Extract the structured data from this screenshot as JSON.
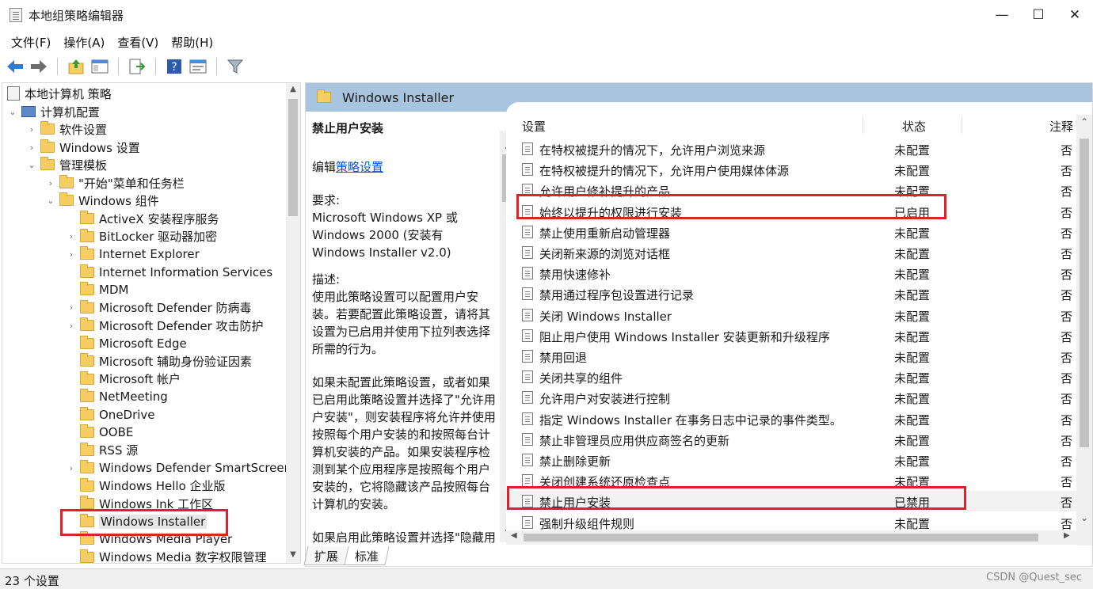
{
  "window": {
    "title": "本地组策略编辑器",
    "minimize": "—",
    "maximize": "☐",
    "close": "✕"
  },
  "menu": [
    "文件(F)",
    "操作(A)",
    "查看(V)",
    "帮助(H)"
  ],
  "toolbar": {
    "back_icon": "back-arrow-icon",
    "forward_icon": "forward-arrow-icon",
    "up_icon": "up-folder-icon",
    "show_hide_icon": "show-hide-tree-icon",
    "export_icon": "export-list-icon",
    "help_icon": "help-icon",
    "properties_icon": "properties-icon",
    "filter_icon": "filter-icon"
  },
  "tree": {
    "root": "本地计算机 策略",
    "computer_config": "计算机配置",
    "software_settings": "软件设置",
    "windows_settings": "Windows 设置",
    "admin_templates": "管理模板",
    "start_menu": "\"开始\"菜单和任务栏",
    "windows_components": "Windows 组件",
    "components": [
      {
        "label": "ActiveX 安装程序服务",
        "has_children": false
      },
      {
        "label": "BitLocker 驱动器加密",
        "has_children": true
      },
      {
        "label": "Internet Explorer",
        "has_children": true
      },
      {
        "label": "Internet Information Services",
        "has_children": false
      },
      {
        "label": "MDM",
        "has_children": false
      },
      {
        "label": "Microsoft Defender 防病毒",
        "has_children": true
      },
      {
        "label": "Microsoft Defender 攻击防护",
        "has_children": true
      },
      {
        "label": "Microsoft Edge",
        "has_children": false
      },
      {
        "label": "Microsoft 辅助身份验证因素",
        "has_children": false
      },
      {
        "label": "Microsoft 帐户",
        "has_children": false
      },
      {
        "label": "NetMeeting",
        "has_children": false
      },
      {
        "label": "OneDrive",
        "has_children": false
      },
      {
        "label": "OOBE",
        "has_children": false
      },
      {
        "label": "RSS 源",
        "has_children": false
      },
      {
        "label": "Windows Defender SmartScreen",
        "has_children": true
      },
      {
        "label": "Windows Hello 企业版",
        "has_children": false
      },
      {
        "label": "Windows Ink 工作区",
        "has_children": false
      },
      {
        "label": "Windows Installer",
        "has_children": false,
        "selected": true
      },
      {
        "label": "Windows Media Player",
        "has_children": false
      },
      {
        "label": "Windows Media 数字权限管理",
        "has_children": false
      }
    ]
  },
  "right_header": "Windows Installer",
  "description": {
    "title": "禁止用户安装",
    "edit_prefix": "编辑",
    "edit_link": "策略设置",
    "requirements": "要求:\nMicrosoft Windows XP 或 Windows 2000 (安装有 Windows Installer v2.0)",
    "desc": "描述:\n使用此策略设置可以配置用户安装。若要配置此策略设置，请将其设置为已启用并使用下拉列表选择所需的行为。",
    "p2": "如果未配置此策略设置，或者如果已启用此策略设置并选择了\"允许用户安装\"，则安装程序将允许并使用按照每个用户安装的和按照每台计算机安装的产品。如果安装程序检测到某个应用程序是按照每个用户安装的，它将隐藏该产品按照每台计算机的安装。",
    "p3": "如果启用此策略设置并选择\"隐藏用"
  },
  "list": {
    "columns": {
      "setting": "设置",
      "state": "状态",
      "note": "注释"
    },
    "rows": [
      {
        "name": "在特权被提升的情况下，允许用户浏览来源",
        "state": "未配置",
        "note": "否"
      },
      {
        "name": "在特权被提升的情况下，允许用户使用媒体体源",
        "state": "未配置",
        "note": "否"
      },
      {
        "name": "允许用户修补提升的产品",
        "state": "未配置",
        "note": "否"
      },
      {
        "name": "始终以提升的权限进行安装",
        "state": "已启用",
        "note": "否",
        "highlight": true
      },
      {
        "name": "禁止使用重新启动管理器",
        "state": "未配置",
        "note": "否"
      },
      {
        "name": "关闭新来源的浏览对话框",
        "state": "未配置",
        "note": "否"
      },
      {
        "name": "禁用快速修补",
        "state": "未配置",
        "note": "否"
      },
      {
        "name": "禁用通过程序包设置进行记录",
        "state": "未配置",
        "note": "否"
      },
      {
        "name": "关闭 Windows Installer",
        "state": "未配置",
        "note": "否"
      },
      {
        "name": "阻止用户使用 Windows Installer 安装更新和升级程序",
        "state": "未配置",
        "note": "否"
      },
      {
        "name": "禁用回退",
        "state": "未配置",
        "note": "否"
      },
      {
        "name": "关闭共享的组件",
        "state": "未配置",
        "note": "否"
      },
      {
        "name": "允许用户对安装进行控制",
        "state": "未配置",
        "note": "否"
      },
      {
        "name": "指定 Windows Installer 在事务日志中记录的事件类型。",
        "state": "未配置",
        "note": "否"
      },
      {
        "name": "禁止非管理员应用供应商签名的更新",
        "state": "未配置",
        "note": "否"
      },
      {
        "name": "禁止删除更新",
        "state": "未配置",
        "note": "否"
      },
      {
        "name": "关闭创建系统还原检查点",
        "state": "未配置",
        "note": "否"
      },
      {
        "name": "禁止用户安装",
        "state": "已禁用",
        "note": "否",
        "highlight": true,
        "selected": true
      },
      {
        "name": "强制升级组件规则",
        "state": "未配置",
        "note": "否"
      }
    ]
  },
  "tabs": [
    "扩展",
    "标准"
  ],
  "status": "23 个设置",
  "watermark": "CSDN @Quest_sec",
  "colors": {
    "header_bg": "#a9c4df",
    "highlight": "#e0202a",
    "folder": "#f5cd60"
  }
}
